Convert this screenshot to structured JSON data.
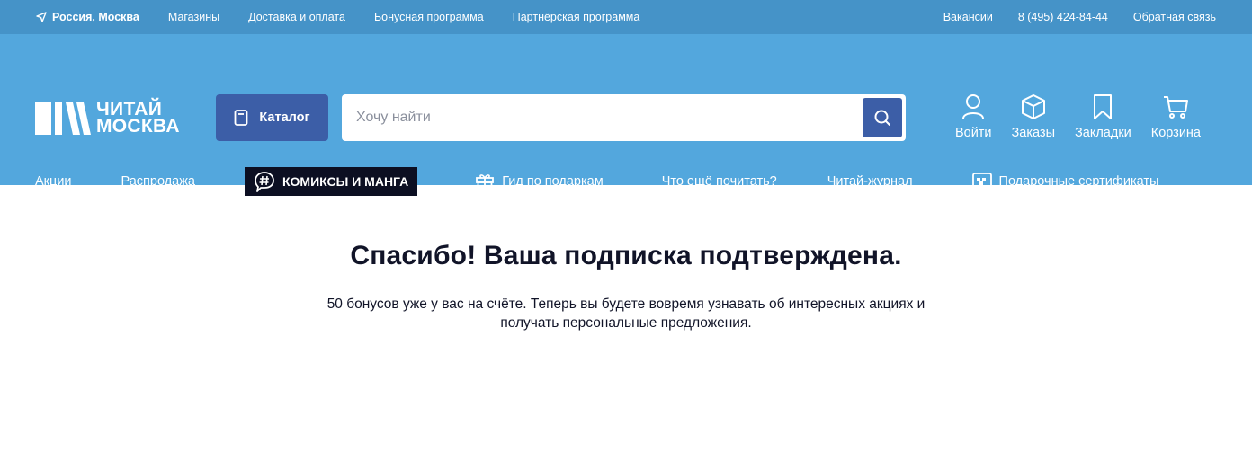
{
  "topbar": {
    "city": "Россия, Москва",
    "links": [
      "Магазины",
      "Доставка и оплата",
      "Бонусная программа",
      "Партнёрская программа"
    ],
    "right_links": [
      "Вакансии",
      "8 (495) 424-84-44",
      "Обратная связь"
    ]
  },
  "header": {
    "logo_line1": "ЧИТАЙ",
    "logo_line2": "МОСКВА",
    "catalog_label": "Каталог",
    "search_placeholder": "Хочу найти",
    "actions": [
      "Войти",
      "Заказы",
      "Закладки",
      "Корзина"
    ]
  },
  "nav": {
    "items": [
      "Акции",
      "Распродажа",
      "КОМИКСЫ И МАНГА",
      "Гид по подаркам",
      "Что ещё почитать?",
      "Читай-журнал",
      "Подарочные сертификаты"
    ]
  },
  "main": {
    "title": "Спасибо! Ваша подписка подтверждена.",
    "message_line1": "50 бонусов уже у вас на счёте. Теперь вы будете вовремя узнавать об интересных акциях и",
    "message_line2": "получать персональные предложения."
  },
  "colors": {
    "topbar": "#4593c8",
    "header": "#53a7dd",
    "accent": "#3c5ea7",
    "comics_bg": "#0c0f22"
  }
}
